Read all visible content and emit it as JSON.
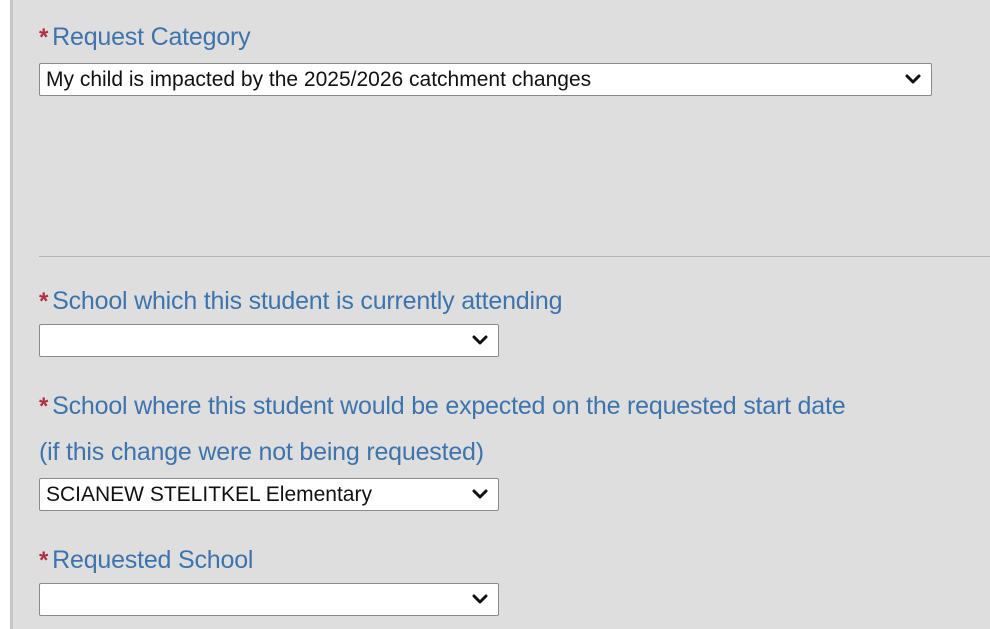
{
  "form": {
    "request_category": {
      "required_mark": "*",
      "label": "Request Category",
      "selected": "My child is impacted by the 2025/2026 catchment changes",
      "icon": "chevron-down-icon"
    },
    "current_school": {
      "required_mark": "*",
      "label": "School which this student is currently attending",
      "selected": "",
      "icon": "chevron-down-icon"
    },
    "expected_school": {
      "required_mark": "*",
      "label": "School where this student would be expected on the requested start date",
      "label_line2": "(if this change were not being requested)",
      "selected": "SCIANEW STELITKEL Elementary",
      "icon": "chevron-down-icon"
    },
    "requested_school": {
      "required_mark": "*",
      "label": "Requested School",
      "selected": "",
      "icon": "chevron-down-icon"
    }
  },
  "colors": {
    "label": "#3e74ad",
    "required": "#b03043",
    "panel_background": "#dedede"
  }
}
